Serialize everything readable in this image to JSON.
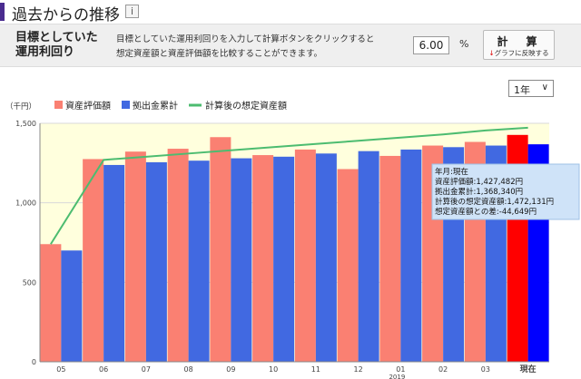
{
  "header": {
    "title": "過去からの推移",
    "info_icon": "info-icon"
  },
  "rate": {
    "title_line1": "目標としていた",
    "title_line2": "運用利回り",
    "desc_line1": "目標としていた運用利回りを入力して計算ボタンをクリックすると",
    "desc_line2": "想定資産額と資産評価額を比較することができます。",
    "value": "6.00",
    "unit": "%",
    "calc_label": "計　算",
    "calc_sub_arrow": "↓",
    "calc_sub": "グラフに反映する"
  },
  "period": {
    "selected": "1年",
    "chevron": "∨"
  },
  "chart_data": {
    "type": "bar",
    "unit_label": "（千円）",
    "categories": [
      "05",
      "06",
      "07",
      "08",
      "09",
      "10",
      "11",
      "12",
      "01",
      "02",
      "03",
      "現在"
    ],
    "year_marker": {
      "category": "01",
      "label": "2019"
    },
    "ylim": [
      0,
      1500
    ],
    "yticks": [
      {
        "value": 0,
        "label": "0"
      },
      {
        "value": 500,
        "label": "500"
      },
      {
        "value": 1000,
        "label": "1,000"
      },
      {
        "value": 1500,
        "label": "1,500"
      }
    ],
    "series": [
      {
        "name": "資産評価額",
        "kind": "bar",
        "color": "#fa8072",
        "highlight_color": "#ff0000",
        "values": [
          740,
          1275,
          1322,
          1340,
          1413,
          1300,
          1335,
          1212,
          1295,
          1360,
          1383,
          1427
        ]
      },
      {
        "name": "拠出金累計",
        "kind": "bar",
        "color": "#4169e1",
        "highlight_color": "#0000ff",
        "values": [
          700,
          1238,
          1255,
          1265,
          1280,
          1290,
          1310,
          1325,
          1335,
          1350,
          1360,
          1368
        ]
      },
      {
        "name": "計算後の想定資産額",
        "kind": "line",
        "color": "#4cbc70",
        "values": [
          740,
          1270,
          1290,
          1310,
          1330,
          1350,
          1370,
          1390,
          1410,
          1430,
          1455,
          1472
        ]
      }
    ],
    "legend_position": "top-left",
    "tooltip": {
      "category": "現在",
      "lines": [
        "年月:現在",
        "資産評価額:1,427,482円",
        "拠出金累計:1,368,340円",
        "計算後の想定資産額:1,472,131円",
        "想定資産額との差:-44,649円"
      ]
    },
    "colors": {
      "plot_bg": "#ffffdd",
      "tooltip_bg": "#cfe3f8"
    }
  }
}
